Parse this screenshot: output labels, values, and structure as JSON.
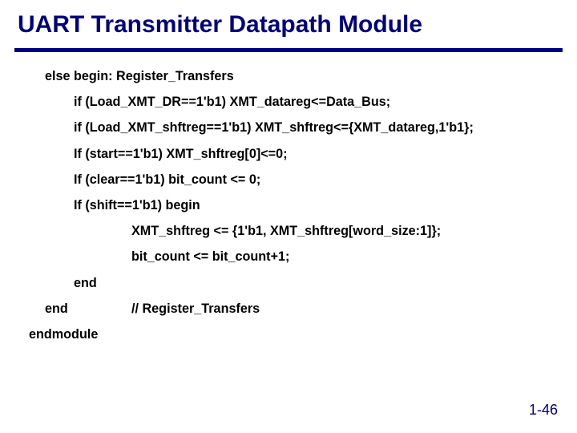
{
  "title": "UART Transmitter Datapath Module",
  "lines": {
    "l0": "else begin: Register_Transfers",
    "l1": "if (Load_XMT_DR==1'b1) XMT_datareg<=Data_Bus;",
    "l2": "if (Load_XMT_shftreg==1'b1) XMT_shftreg<={XMT_datareg,1'b1};",
    "l3": "If (start==1'b1) XMT_shftreg[0]<=0;",
    "l4": "If (clear==1'b1) bit_count <= 0;",
    "l5": "If (shift==1'b1) begin",
    "l6": "XMT_shftreg <= {1'b1, XMT_shftreg[word_size:1]};",
    "l7": "bit_count <= bit_count+1;",
    "l8": "end",
    "l9a": "end",
    "l9b": "// Register_Transfers",
    "l10": "endmodule"
  },
  "pagenum": "1-46"
}
